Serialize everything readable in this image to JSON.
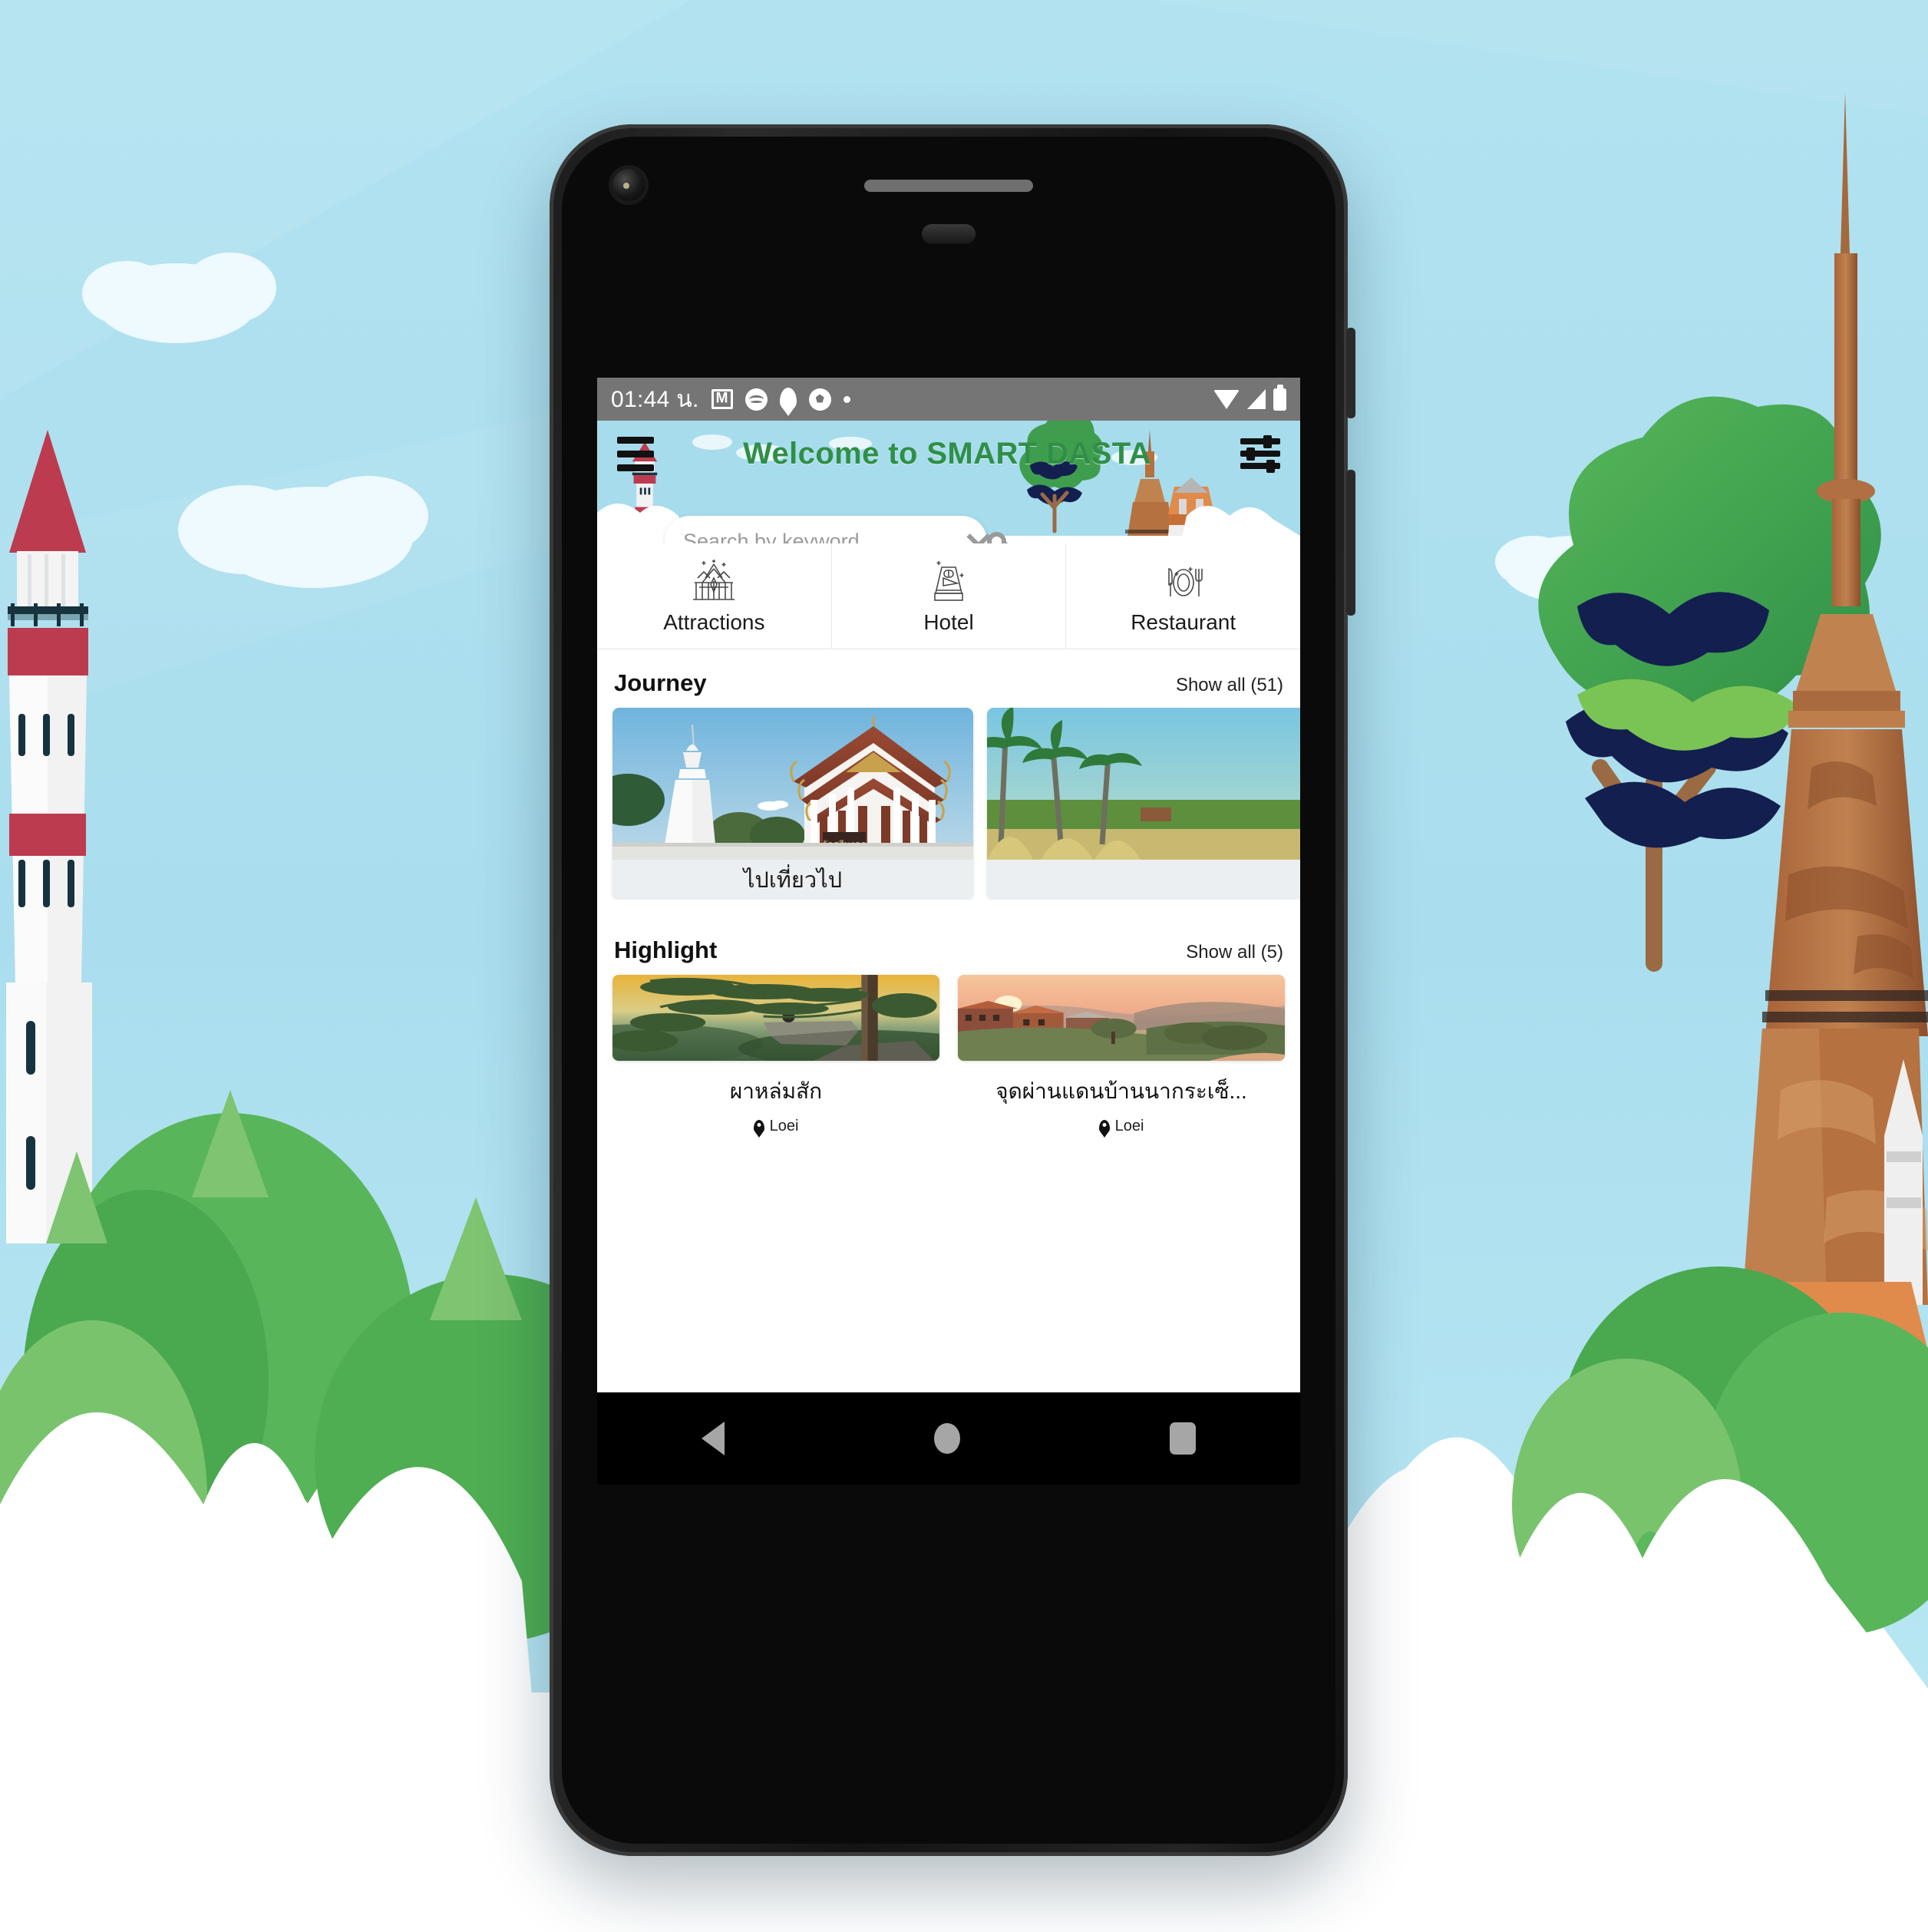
{
  "background": {
    "sky_color": "#ade0ef",
    "cloud_color": "#eefaff",
    "lighthouse_red": "#bd3b4f",
    "pagoda_brown": "#b5713f",
    "grass_green": "#5cb85c"
  },
  "statusbar": {
    "time": "01:44 น.",
    "icons": [
      "gmail-icon",
      "spotify-icon",
      "location-pin-icon",
      "soccer-ball-icon",
      "dot-icon"
    ],
    "right_icons": [
      "wifi-icon",
      "signal-icon",
      "battery-icon"
    ]
  },
  "header": {
    "menu_icon": "hamburger-menu-icon",
    "title": "Welcome to SMART DASTA",
    "title_color": "#2f8f47",
    "filter_icon": "filter-sliders-icon"
  },
  "search": {
    "placeholder": "Search by keyword",
    "value": "",
    "dropdown_icon": "chevron-down-icon",
    "search_icon": "search-icon"
  },
  "categories": [
    {
      "label": "Attractions",
      "icon": "temple-icon"
    },
    {
      "label": "Hotel",
      "icon": "bed-icon"
    },
    {
      "label": "Restaurant",
      "icon": "cutlery-plate-icon"
    }
  ],
  "journey": {
    "title": "Journey",
    "show_all": "Show all (51)",
    "cards": [
      {
        "caption": "ไปเที่ยวไป",
        "image": "thai-temple-white-stupa"
      },
      {
        "caption": "",
        "image": "palm-trees-field"
      }
    ]
  },
  "highlight": {
    "title": "Highlight",
    "show_all": "Show all (5)",
    "cards": [
      {
        "title": "ผาหล่มสัก",
        "location": "Loei",
        "location_icon": "map-pin-icon",
        "image": "cliff-sunset-pine-tree"
      },
      {
        "title": "จุดผ่านแดนบ้านนากระเซ็...",
        "location": "Loei",
        "location_icon": "map-pin-icon",
        "image": "riverside-village-sunset"
      }
    ]
  },
  "android_nav": {
    "back": "back-triangle-icon",
    "home": "home-circle-icon",
    "recents": "recents-square-icon"
  }
}
